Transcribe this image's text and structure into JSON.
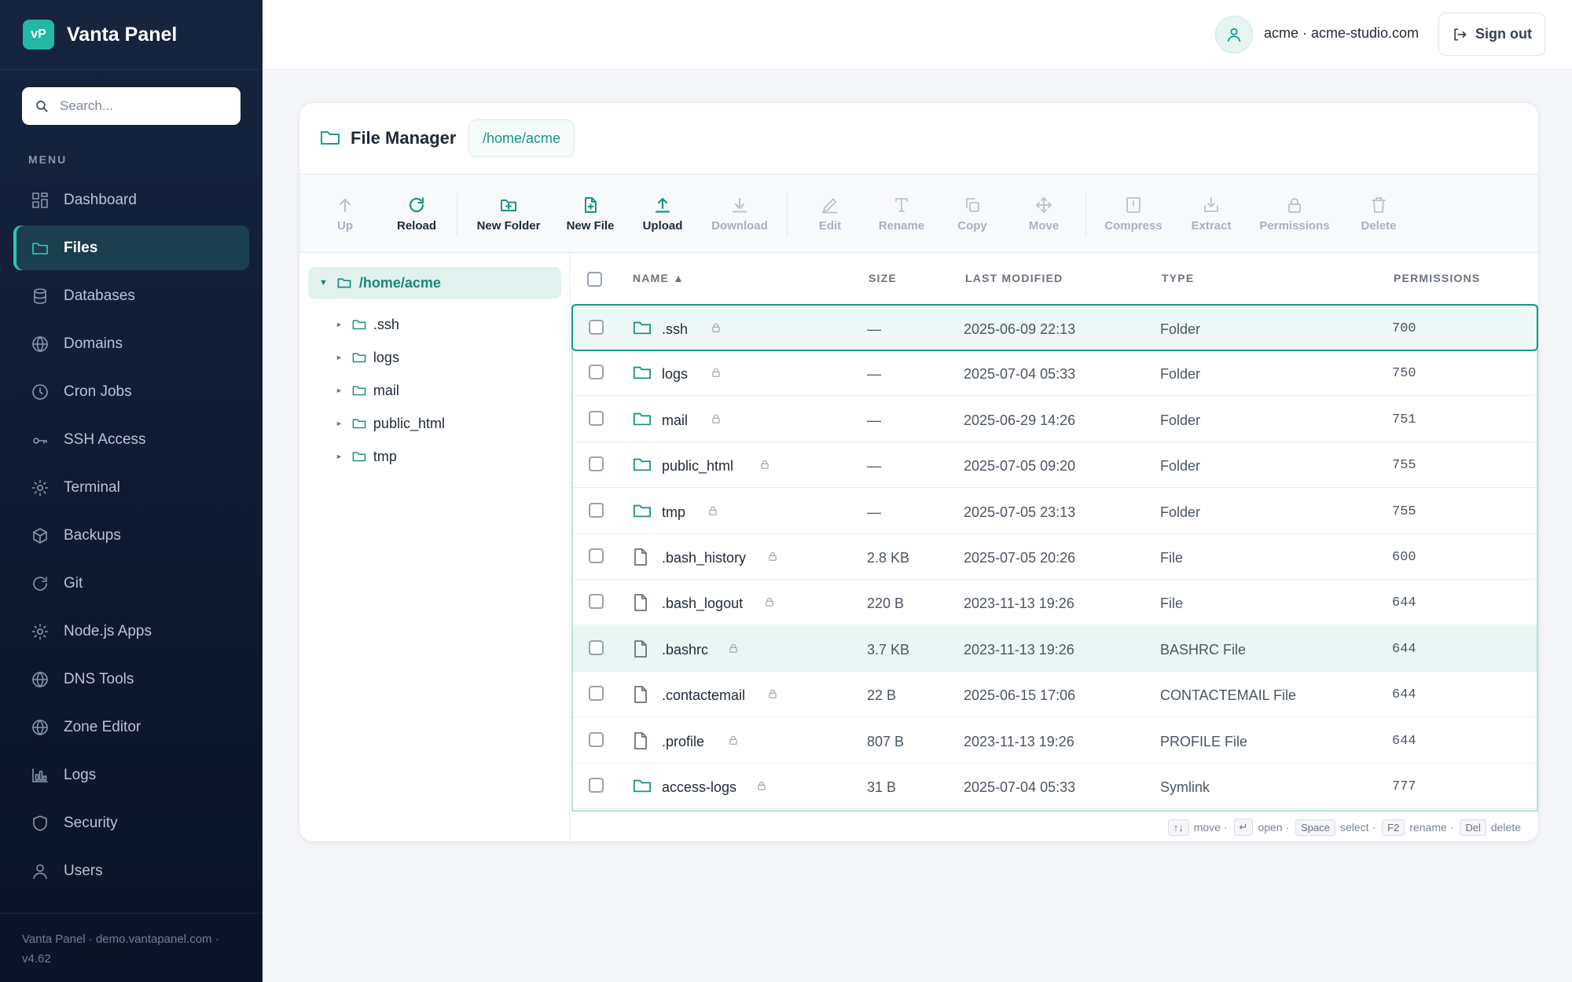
{
  "brand": {
    "logo": "vP",
    "name": "Vanta Panel"
  },
  "search": {
    "placeholder": "Search..."
  },
  "menu_label": "MENU",
  "nav": [
    {
      "label": "Dashboard",
      "icon": "dashboard-icon",
      "active": false
    },
    {
      "label": "Files",
      "icon": "folder-icon",
      "active": true
    },
    {
      "label": "Databases",
      "icon": "database-icon",
      "active": false
    },
    {
      "label": "Domains",
      "icon": "globe-icon",
      "active": false
    },
    {
      "label": "Cron Jobs",
      "icon": "clock-icon",
      "active": false
    },
    {
      "label": "SSH Access",
      "icon": "key-icon",
      "active": false
    },
    {
      "label": "Terminal",
      "icon": "sun-icon",
      "active": false
    },
    {
      "label": "Backups",
      "icon": "box-icon",
      "active": false
    },
    {
      "label": "Git",
      "icon": "refresh-icon",
      "active": false
    },
    {
      "label": "Node.js Apps",
      "icon": "sun-icon",
      "active": false
    },
    {
      "label": "DNS Tools",
      "icon": "globe-icon",
      "active": false
    },
    {
      "label": "Zone Editor",
      "icon": "globe-icon",
      "active": false
    },
    {
      "label": "Logs",
      "icon": "bar-chart-icon",
      "active": false
    },
    {
      "label": "Security",
      "icon": "shield-icon",
      "active": false
    },
    {
      "label": "Users",
      "icon": "user-icon",
      "active": false
    }
  ],
  "sidebar_footer": "Vanta Panel · demo.vantapanel.com · v4.62",
  "topbar": {
    "account": "acme · acme-studio.com",
    "signout": "Sign out"
  },
  "file_manager": {
    "title": "File Manager",
    "path": "/home/acme",
    "toolbar": [
      {
        "label": "Up",
        "icon": "arrow-up-icon",
        "enabled": false
      },
      {
        "label": "Reload",
        "icon": "reload-icon",
        "enabled": true
      },
      {
        "label": "New Folder",
        "icon": "new-folder-icon",
        "enabled": true
      },
      {
        "label": "New File",
        "icon": "new-file-icon",
        "enabled": true
      },
      {
        "label": "Upload",
        "icon": "upload-icon",
        "enabled": true
      },
      {
        "label": "Download",
        "icon": "download-icon",
        "enabled": false
      },
      {
        "label": "Edit",
        "icon": "pencil-icon",
        "enabled": false
      },
      {
        "label": "Rename",
        "icon": "text-icon",
        "enabled": false
      },
      {
        "label": "Copy",
        "icon": "copy-icon",
        "enabled": false
      },
      {
        "label": "Move",
        "icon": "move-icon",
        "enabled": false
      },
      {
        "label": "Compress",
        "icon": "archive-icon",
        "enabled": false
      },
      {
        "label": "Extract",
        "icon": "extract-icon",
        "enabled": false
      },
      {
        "label": "Permissions",
        "icon": "lock-icon",
        "enabled": false
      },
      {
        "label": "Delete",
        "icon": "trash-icon",
        "enabled": false
      }
    ],
    "tree": {
      "root": "/home/acme",
      "children": [
        ".ssh",
        "logs",
        "mail",
        "public_html",
        "tmp"
      ]
    },
    "columns": {
      "name": "NAME ▲",
      "size": "SIZE",
      "modified": "LAST MODIFIED",
      "type": "TYPE",
      "permissions": "PERMISSIONS"
    },
    "rows": [
      {
        "name": ".ssh",
        "kind": "folder",
        "size": "—",
        "modified": "2025-06-09 22:13",
        "type": "Folder",
        "perm": "700"
      },
      {
        "name": "logs",
        "kind": "folder",
        "size": "—",
        "modified": "2025-07-04 05:33",
        "type": "Folder",
        "perm": "750"
      },
      {
        "name": "mail",
        "kind": "folder",
        "size": "—",
        "modified": "2025-06-29 14:26",
        "type": "Folder",
        "perm": "751"
      },
      {
        "name": "public_html",
        "kind": "folder",
        "size": "—",
        "modified": "2025-07-05 09:20",
        "type": "Folder",
        "perm": "755"
      },
      {
        "name": "tmp",
        "kind": "folder",
        "size": "—",
        "modified": "2025-07-05 23:13",
        "type": "Folder",
        "perm": "755"
      },
      {
        "name": ".bash_history",
        "kind": "file",
        "size": "2.8 KB",
        "modified": "2025-07-05 20:26",
        "type": "File",
        "perm": "600"
      },
      {
        "name": ".bash_logout",
        "kind": "file",
        "size": "220 B",
        "modified": "2023-11-13 19:26",
        "type": "File",
        "perm": "644"
      },
      {
        "name": ".bashrc",
        "kind": "file",
        "size": "3.7 KB",
        "modified": "2023-11-13 19:26",
        "type": "BASHRC File",
        "perm": "644"
      },
      {
        "name": ".contactemail",
        "kind": "file",
        "size": "22 B",
        "modified": "2025-06-15 17:06",
        "type": "CONTACTEMAIL File",
        "perm": "644"
      },
      {
        "name": ".profile",
        "kind": "file",
        "size": "807 B",
        "modified": "2023-11-13 19:26",
        "type": "PROFILE File",
        "perm": "644"
      },
      {
        "name": "access-logs",
        "kind": "folder",
        "size": "31 B",
        "modified": "2025-07-04 05:33",
        "type": "Symlink",
        "perm": "777"
      }
    ],
    "hints": [
      {
        "key": "↑↓",
        "text": "move ·"
      },
      {
        "key": "↵",
        "text": "open ·"
      },
      {
        "key": "Space",
        "text": "select ·"
      },
      {
        "key": "F2",
        "text": "rename ·"
      },
      {
        "key": "Del",
        "text": "delete"
      }
    ]
  },
  "colors": {
    "accent": "#1a9484",
    "sidebar": "#0f1a30",
    "active_nav": "#1b3f4c"
  }
}
